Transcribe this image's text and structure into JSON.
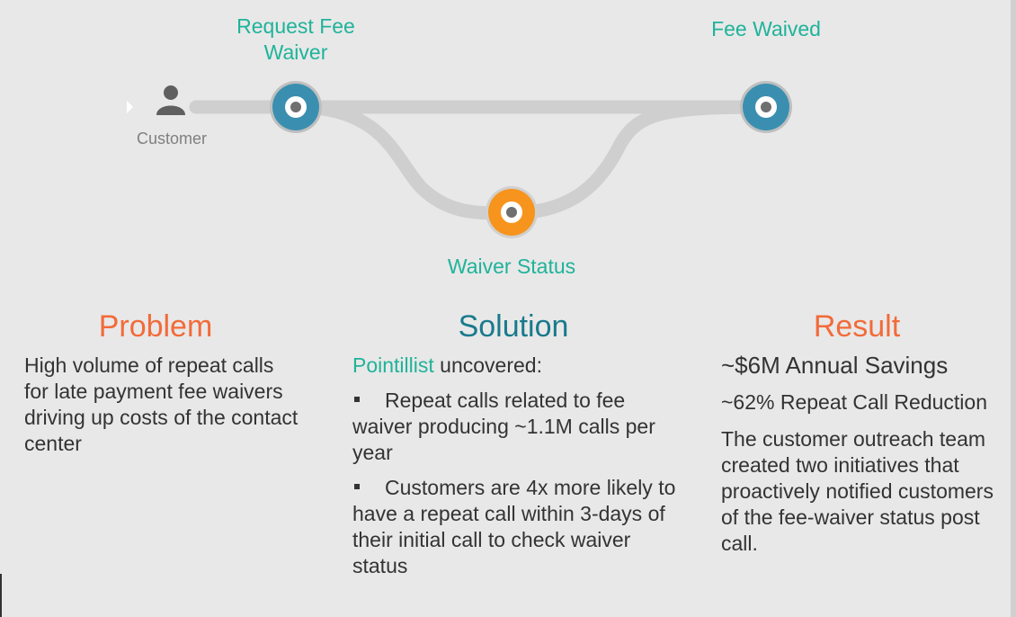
{
  "diagram": {
    "customer_label": "Customer",
    "nodes": {
      "request": {
        "label": "Request Fee Waiver",
        "color": "#3a8fb0"
      },
      "fee_waived": {
        "label": "Fee Waived",
        "color": "#3a8fb0"
      },
      "waiver_status": {
        "label": "Waiver Status",
        "color": "#f7941d"
      }
    },
    "label_color": "#1fb39a"
  },
  "problem": {
    "title": "Problem",
    "title_color": "#f26b3a",
    "text": "High volume of repeat calls for late payment fee waivers driving up costs of the contact center"
  },
  "solution": {
    "title": "Solution",
    "title_color": "#197a8c",
    "intro_brand": "Pointillist",
    "intro_rest": " uncovered:",
    "bullets": [
      "Repeat calls related to fee waiver producing ~1.1M calls per year",
      "Customers are 4x more likely to have a repeat call within 3-days of their initial call to check waiver status"
    ]
  },
  "result": {
    "title": "Result",
    "title_color": "#f26b3a",
    "savings": "~$6M Annual Savings",
    "reduction": "~62% Repeat Call Reduction",
    "text": "The customer outreach team created two initiatives that proactively notified customers of the fee-waiver status post call."
  }
}
